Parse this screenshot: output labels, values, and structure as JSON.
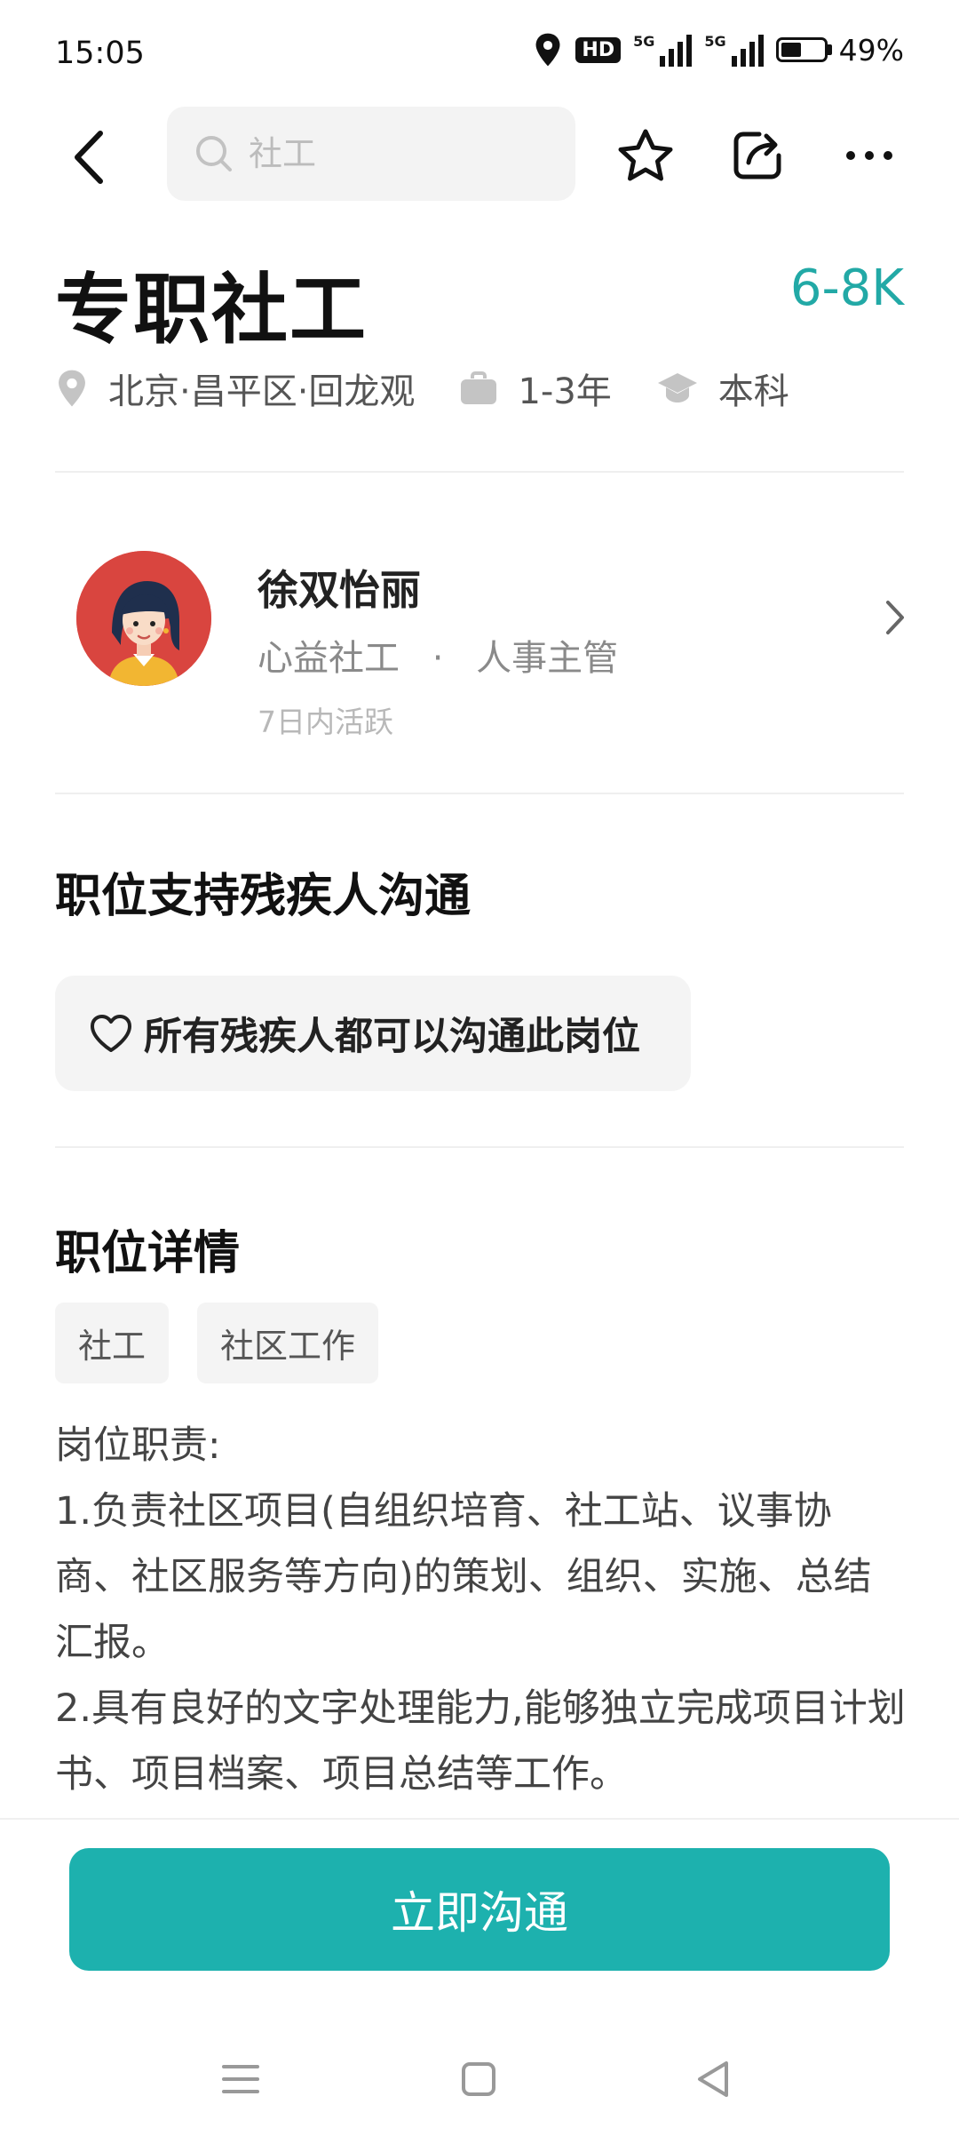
{
  "status_bar": {
    "time": "15:05",
    "hd_label": "HD",
    "signal_1_label": "5G",
    "signal_2_label": "5G",
    "battery_percent": "49%",
    "battery_level": 0.49
  },
  "nav": {
    "search_placeholder": "社工"
  },
  "job": {
    "title": "专职社工",
    "salary": "6-8K",
    "location": "北京·昌平区·回龙观",
    "experience": "1-3年",
    "education": "本科"
  },
  "recruiter": {
    "name": "徐双怡丽",
    "company": "心益社工",
    "separator": "·",
    "role": "人事主管",
    "activity": "7日内活跃"
  },
  "disability": {
    "section_title": "职位支持残疾人沟通",
    "chip_label": "所有残疾人都可以沟通此岗位"
  },
  "details": {
    "section_title": "职位详情",
    "tags": [
      "社工",
      "社区工作"
    ],
    "description": [
      "岗位职责:",
      "1.负责社区项目(自组织培育、社工站、议事协商、社区服务等方向)的策划、组织、实施、总结汇报。",
      "2.具有良好的文字处理能力,能够独立完成项目计划书、项目档案、项目总结等工作。"
    ]
  },
  "cta": {
    "label": "立即沟通"
  },
  "colors": {
    "accent": "#1db1ae",
    "salary": "#22a9a6"
  },
  "icons": {
    "back": "chevron-left-icon",
    "search": "search-icon",
    "favorite": "star-icon",
    "share": "share-icon",
    "more": "more-icon",
    "location": "location-pin-icon",
    "experience": "briefcase-icon",
    "education": "graduation-cap-icon",
    "chip": "heart-icon"
  }
}
